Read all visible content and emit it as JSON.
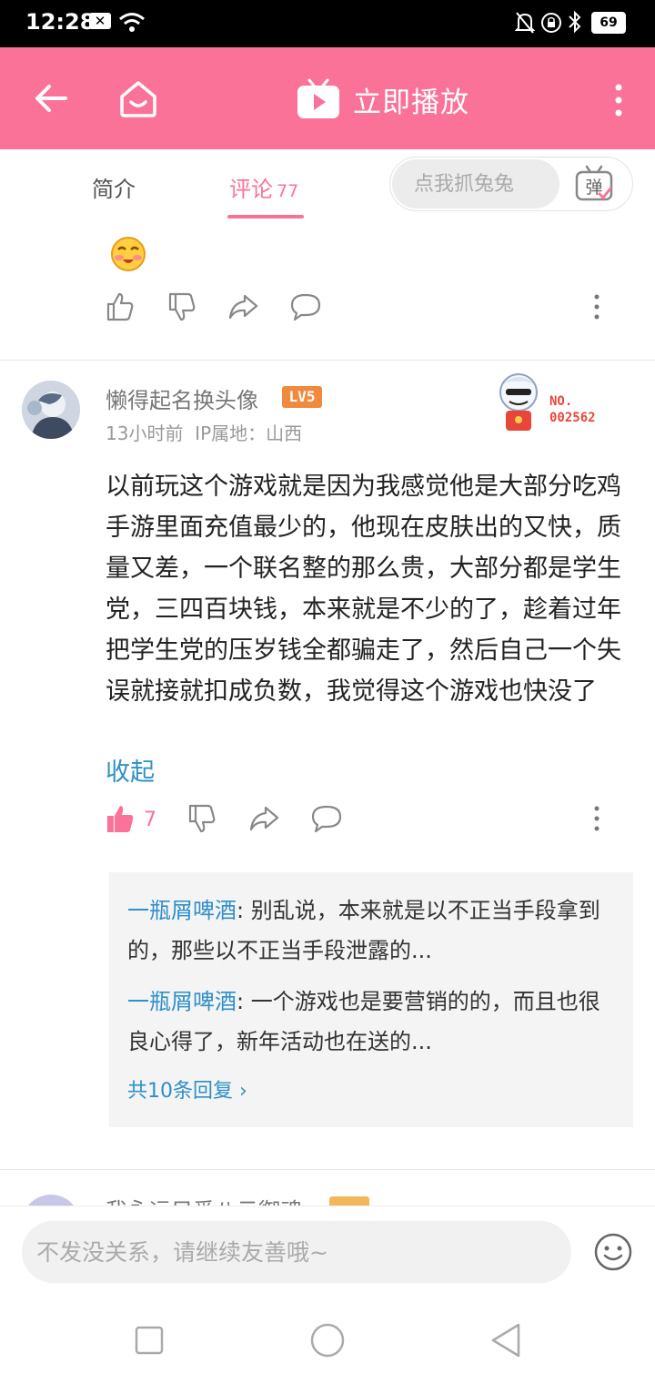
{
  "status_bar": {
    "time": "12:28",
    "battery": "69"
  },
  "app_bar": {
    "title": "立即播放"
  },
  "tabs": {
    "intro": "简介",
    "comments": "评论",
    "comments_count": "77",
    "danmaku_placeholder": "点我抓兔兔",
    "danmaku_toggle_label": "弹"
  },
  "comment": {
    "username": "懒得起名换头像",
    "level": "LV5",
    "time": "13小时前",
    "ip_location": "IP属地：山西",
    "fan_no_label": "NO.",
    "fan_no": "002562",
    "text": "以前玩这个游戏就是因为我感觉他是大部分吃鸡手游里面充值最少的，他现在皮肤出的又快，质量又差，一个联名整的那么贵，大部分都是学生党，三四百块钱，本来就是不少的了，趁着过年把学生党的压岁钱全都骗走了，然后自己一个失误就接就扣成负数，我觉得这个游戏也快没了",
    "collapse_label": "收起",
    "like_count": "7",
    "replies": [
      {
        "user": "一瓶屑啤酒",
        "text": ": 别乱说，本来就是以不正当手段拿到的，那些以不正当手段泄露的..."
      },
      {
        "user": "一瓶屑啤酒",
        "text": ": 一个游戏也是要营销的的，而且也很良心得了，新年活动也在送的..."
      }
    ],
    "more_replies": "共10条回复 ›"
  },
  "next_comment": {
    "username": "我永远只爱八云御魂"
  },
  "bottom": {
    "input_placeholder": "不发没关系，请继续友善哦~"
  },
  "colors": {
    "brand_pink": "#fb7299",
    "link_blue": "#2f8fc8",
    "level_orange": "#f08a3e"
  }
}
